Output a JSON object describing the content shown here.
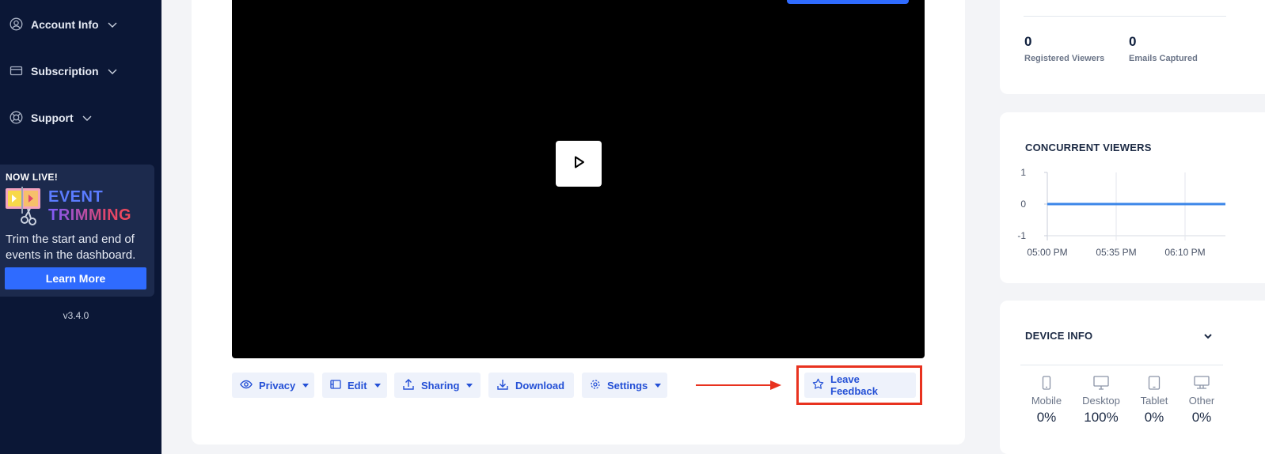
{
  "sidebar": {
    "items": [
      {
        "label": "Account Info",
        "icon": "user-circle-icon"
      },
      {
        "label": "Subscription",
        "icon": "credit-card-icon"
      },
      {
        "label": "Support",
        "icon": "lifebuoy-icon"
      }
    ],
    "promo": {
      "badge": "NOW LIVE!",
      "title_line1": "EVENT",
      "title_line2": "TRIMMING",
      "description": "Trim the start and end of events in the dashboard.",
      "button": "Learn More"
    },
    "version": "v3.4.0"
  },
  "toolbar": {
    "privacy": "Privacy",
    "edit": "Edit",
    "sharing": "Sharing",
    "download": "Download",
    "settings": "Settings",
    "feedback": "Leave Feedback"
  },
  "stats": {
    "registered_value": "0",
    "registered_label": "Registered Viewers",
    "emails_value": "0",
    "emails_label": "Emails Captured"
  },
  "chart_data": {
    "type": "line",
    "title": "CONCURRENT VIEWERS",
    "x": [
      "05:00 PM",
      "05:35 PM",
      "06:10 PM"
    ],
    "series": [
      {
        "values": [
          0,
          0,
          0,
          0
        ]
      }
    ],
    "ylim": [
      -1,
      1
    ],
    "yticks": [
      "1",
      "0",
      "-1"
    ],
    "grid": true,
    "color": "#3b86e8"
  },
  "device_info": {
    "title": "DEVICE INFO",
    "devices": [
      {
        "label": "Mobile",
        "value": "0%",
        "icon": "mobile-icon"
      },
      {
        "label": "Desktop",
        "value": "100%",
        "icon": "desktop-icon"
      },
      {
        "label": "Tablet",
        "value": "0%",
        "icon": "tablet-icon"
      },
      {
        "label": "Other",
        "value": "0%",
        "icon": "monitor-icon"
      }
    ]
  },
  "colors": {
    "sidebar_bg": "#0b1736",
    "accent": "#2f6bff",
    "highlight": "#e8321f"
  }
}
